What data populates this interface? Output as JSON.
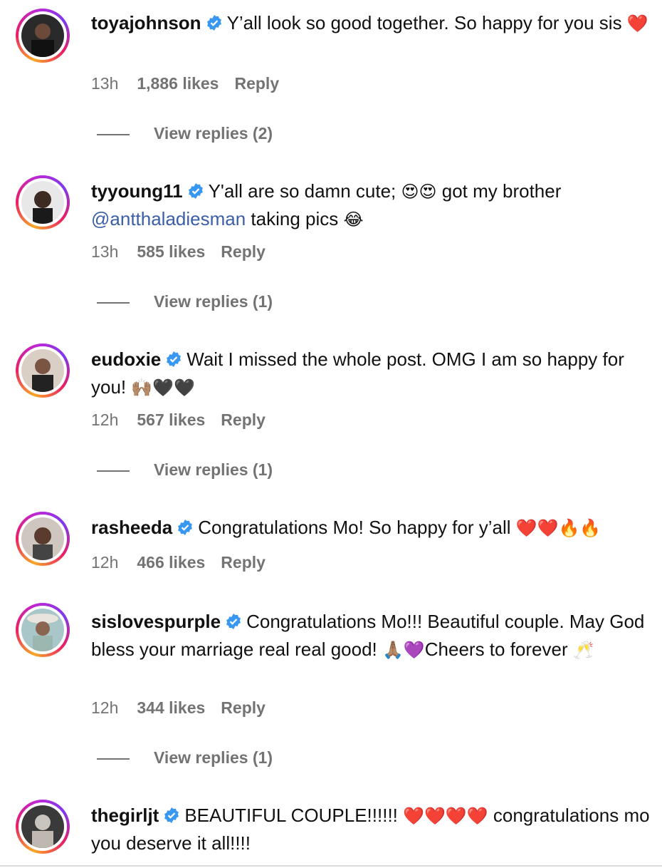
{
  "comments": [
    {
      "username": "toyajohnson",
      "text_parts": [
        "Y’all look so good together. So happy for you sis ",
        "❤️"
      ],
      "time": "13h",
      "likes": "1,886 likes",
      "reply": "Reply",
      "view_replies": "View replies (2)"
    },
    {
      "username": "tyyoung11",
      "text_parts": [
        "Y'all are so damn cute; ",
        "😍😍",
        " got my brother ",
        "@antthaladiesman",
        " taking pics ",
        "😂"
      ],
      "time": "13h",
      "likes": "585 likes",
      "reply": "Reply",
      "view_replies": "View replies (1)"
    },
    {
      "username": "eudoxie",
      "text_parts": [
        "Wait I missed the whole post. OMG I am so happy for you! ",
        "🙌🏽🖤🖤"
      ],
      "time": "12h",
      "likes": "567 likes",
      "reply": "Reply",
      "view_replies": "View replies (1)"
    },
    {
      "username": "rasheeda",
      "text_parts": [
        "Congratulations Mo! So happy for y’all ",
        "❤️❤️🔥🔥"
      ],
      "time": "12h",
      "likes": "466 likes",
      "reply": "Reply"
    },
    {
      "username": "sislovespurple",
      "text_parts": [
        "Congratulations Mo!!! Beautiful couple. May God bless your marriage real real good! ",
        "🙏🏽💜",
        "Cheers to forever ",
        "🥂"
      ],
      "time": "12h",
      "likes": "344 likes",
      "reply": "Reply",
      "view_replies": "View replies (1)"
    },
    {
      "username": "thegirljt",
      "text_parts": [
        "BEAUTIFUL COUPLE!!!!!! ",
        "❤️❤️❤️❤️",
        " congratulations mo you deserve it all!!!!"
      ]
    }
  ],
  "icons": {
    "verified": "verified-badge-icon",
    "avatar": "avatar"
  },
  "colors": {
    "verified": "#3897f0",
    "mention": "#3b5ea8",
    "muted": "#737373"
  }
}
